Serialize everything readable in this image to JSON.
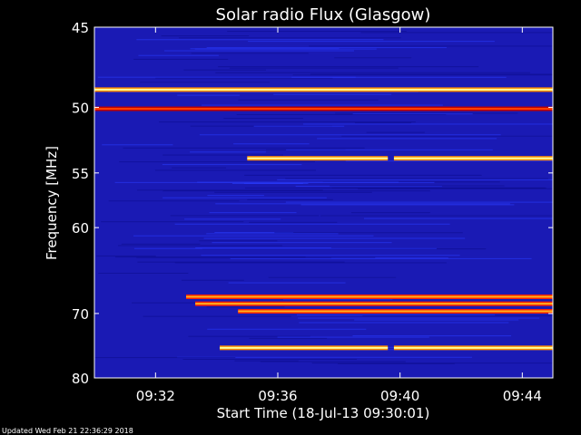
{
  "chart_data": {
    "type": "heatmap",
    "title": "Solar radio Flux (Glasgow)",
    "ylabel": "Frequency [MHz]",
    "xlabel": "Start Time (18-Jul-13 09:30:01)",
    "x_ticks": [
      "09:32",
      "09:36",
      "09:40",
      "09:44"
    ],
    "y_ticks": [
      "45",
      "50",
      "55",
      "60",
      "70",
      "80"
    ],
    "x_tick_minutes": [
      2,
      6,
      10,
      14
    ],
    "y_tick_mhz": [
      45,
      50,
      55,
      60,
      70,
      80
    ],
    "x_range_minutes": [
      0,
      15
    ],
    "y_range_mhz": [
      45,
      80
    ],
    "y_scale": "reciprocal",
    "colormap": [
      "#000000",
      "#1a1ab4",
      "#2040ff",
      "#cc0000",
      "#ff8000",
      "#ffff66",
      "#ffffff"
    ],
    "background_color": "#1a1ab4",
    "emission_lines": [
      {
        "freq_mhz": 48.8,
        "t_start": 0.0,
        "t_end": 15.0,
        "intensity": "high"
      },
      {
        "freq_mhz": 50.1,
        "t_start": 0.0,
        "t_end": 15.0,
        "intensity": "low"
      },
      {
        "freq_mhz": 53.8,
        "t_start": 5.0,
        "t_end": 9.6,
        "intensity": "high"
      },
      {
        "freq_mhz": 53.8,
        "t_start": 9.8,
        "t_end": 15.0,
        "intensity": "high"
      },
      {
        "freq_mhz": 67.8,
        "t_start": 3.0,
        "t_end": 15.0,
        "intensity": "medium"
      },
      {
        "freq_mhz": 68.7,
        "t_start": 3.3,
        "t_end": 15.0,
        "intensity": "medium"
      },
      {
        "freq_mhz": 69.7,
        "t_start": 4.7,
        "t_end": 15.0,
        "intensity": "medium"
      },
      {
        "freq_mhz": 75.0,
        "t_start": 4.1,
        "t_end": 9.6,
        "intensity": "high"
      },
      {
        "freq_mhz": 75.0,
        "t_start": 9.8,
        "t_end": 15.0,
        "intensity": "high"
      }
    ]
  },
  "footer": {
    "updated": "Updated Wed Feb 21 22:36:29 2018"
  }
}
